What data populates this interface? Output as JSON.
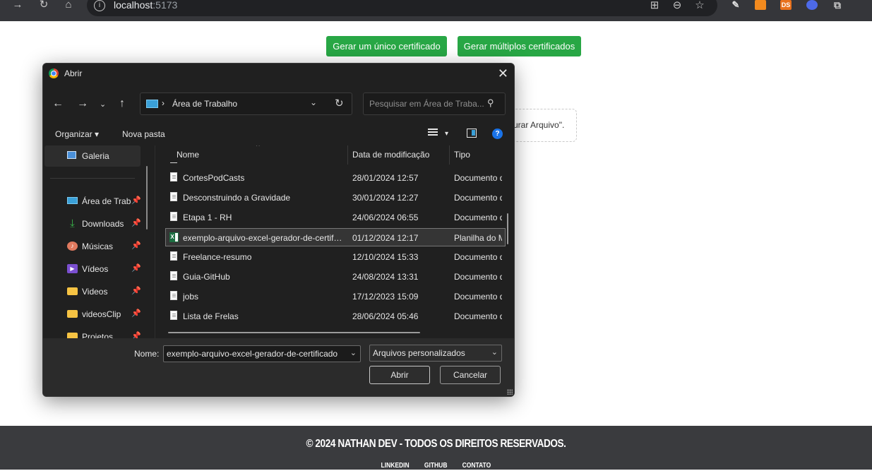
{
  "browser": {
    "url_host": "localhost",
    "url_port": ":5173",
    "extensions": [
      {
        "name": "eyedropper-ext-icon",
        "label": "",
        "color": "#e0e0e0"
      },
      {
        "name": "fox-ext-icon",
        "label": "",
        "color": "#f28a1e"
      },
      {
        "name": "ds-ext-icon",
        "label": "DS",
        "color": "#e8711c"
      },
      {
        "name": "firefox-ext-icon",
        "label": "",
        "color": "#4d6ae8"
      }
    ]
  },
  "page": {
    "btn_single": "Gerar um único certificado",
    "btn_multiple": "Gerar múltiplos certificados",
    "drop_hint": "urar Arquivo\".",
    "accent": "#28a745"
  },
  "dialog": {
    "title": "Abrir",
    "path_label": "Área de Trabalho",
    "search_placeholder": "Pesquisar em Área de Traba...",
    "organize": "Organizar",
    "new_folder": "Nova pasta",
    "sidebar": [
      {
        "label": "Galeria",
        "icon": "gallery-icon",
        "pinned": false,
        "selected": true
      },
      {
        "label": "Área de Trabalho",
        "icon": "desktop-icon",
        "pinned": true
      },
      {
        "label": "Downloads",
        "icon": "download-icon",
        "pinned": true
      },
      {
        "label": "Músicas",
        "icon": "music-icon",
        "pinned": true
      },
      {
        "label": "Vídeos",
        "icon": "video-icon",
        "pinned": true
      },
      {
        "label": "Videos",
        "icon": "folder-icon",
        "pinned": true
      },
      {
        "label": "videosClip",
        "icon": "folder-icon",
        "pinned": true
      },
      {
        "label": "Projetos",
        "icon": "folder-icon",
        "pinned": true
      }
    ],
    "columns": {
      "name": "Nome",
      "modified": "Data de modificação",
      "type": "Tipo"
    },
    "files": [
      {
        "name": "CortesPodCasts",
        "modified": "28/01/2024 12:57",
        "type": "Documento do Word",
        "icon": "document-icon",
        "selected": false
      },
      {
        "name": "Desconstruindo a Gravidade",
        "modified": "30/01/2024 12:27",
        "type": "Documento do Word",
        "icon": "document-icon",
        "selected": false
      },
      {
        "name": "Etapa 1 - RH",
        "modified": "24/06/2024 06:55",
        "type": "Documento do Word",
        "icon": "document-icon",
        "selected": false
      },
      {
        "name": "exemplo-arquivo-excel-gerador-de-certificado",
        "modified": "01/12/2024 12:17",
        "type": "Planilha do Microsoft Excel",
        "icon": "excel-icon",
        "selected": true
      },
      {
        "name": "Freelance-resumo",
        "modified": "12/10/2024 15:33",
        "type": "Documento do Word",
        "icon": "document-icon",
        "selected": false
      },
      {
        "name": "Guia-GitHub",
        "modified": "24/08/2024 13:31",
        "type": "Documento do Word",
        "icon": "document-icon",
        "selected": false
      },
      {
        "name": "jobs",
        "modified": "17/12/2023 15:09",
        "type": "Documento do Word",
        "icon": "document-icon",
        "selected": false
      },
      {
        "name": "Lista de Frelas",
        "modified": "28/06/2024 05:46",
        "type": "Documento do Word",
        "icon": "document-icon",
        "selected": false
      }
    ],
    "filename_label": "Nome:",
    "filename_value": "exemplo-arquivo-excel-gerador-de-certificado",
    "filetype_value": "Arquivos personalizados",
    "open_label": "Abrir",
    "cancel_label": "Cancelar"
  },
  "footer": {
    "copyright": "© 2024 NATHAN DEV - TODOS OS DIREITOS RESERVADOS.",
    "links": [
      "LINKEDIN",
      "GITHUB",
      "CONTATO"
    ]
  }
}
